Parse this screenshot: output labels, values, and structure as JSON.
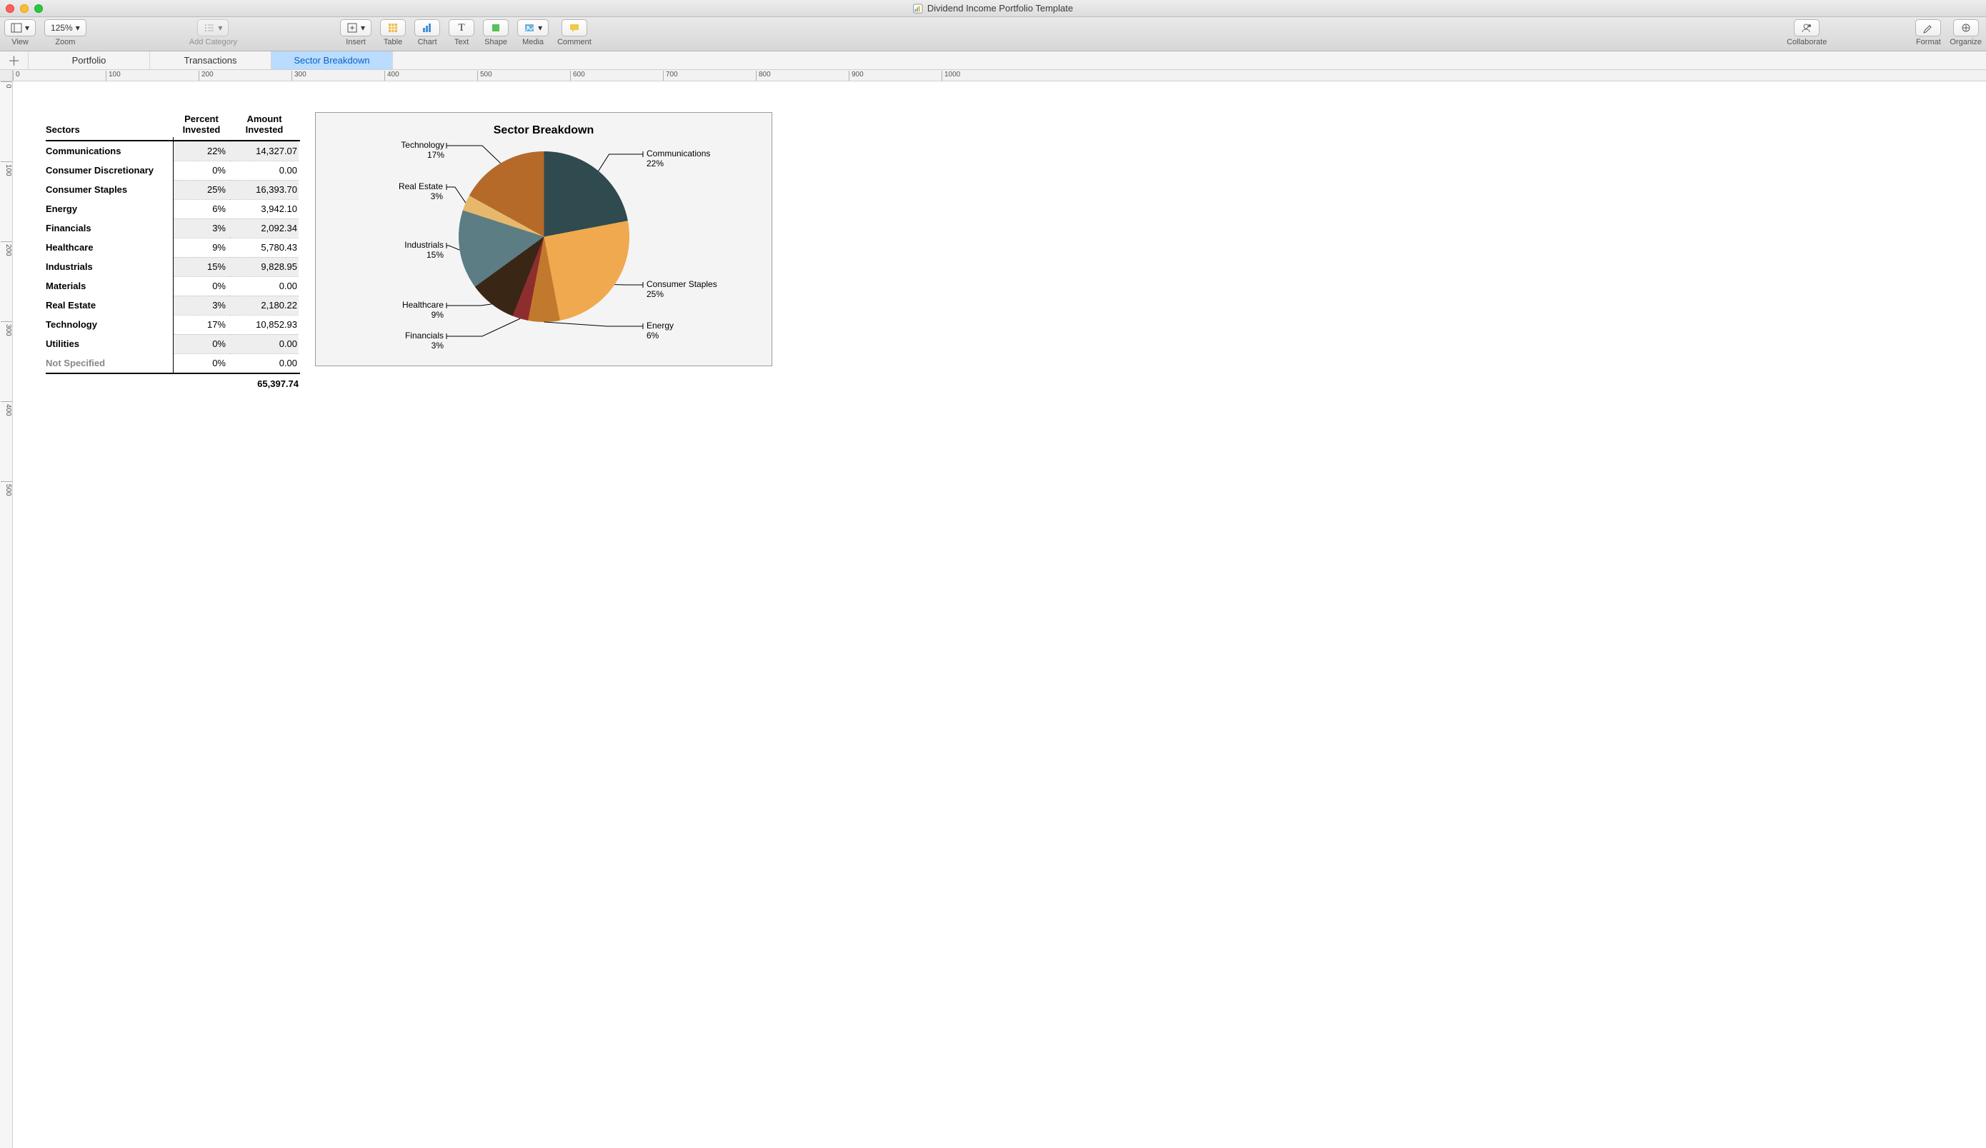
{
  "window": {
    "title": "Dividend Income Portfolio Template"
  },
  "toolbar": {
    "view": "View",
    "zoom_label": "Zoom",
    "zoom_value": "125%",
    "add_category": "Add Category",
    "insert": "Insert",
    "table": "Table",
    "chart": "Chart",
    "text": "Text",
    "shape": "Shape",
    "media": "Media",
    "comment": "Comment",
    "collaborate": "Collaborate",
    "format": "Format",
    "organize": "Organize"
  },
  "tabs": {
    "items": [
      {
        "label": "Portfolio"
      },
      {
        "label": "Transactions"
      },
      {
        "label": "Sector Breakdown"
      }
    ],
    "active_index": 2
  },
  "ruler": {
    "h": [
      "0",
      "100",
      "200",
      "300",
      "400",
      "500",
      "600",
      "700",
      "800",
      "900",
      "1000"
    ],
    "v": [
      "0",
      "100",
      "200",
      "300",
      "400",
      "500"
    ]
  },
  "table": {
    "title": "Sectors",
    "col1": "Percent Invested",
    "col2": "Amount Invested",
    "rows": [
      {
        "sector": "Communications",
        "pct": "22%",
        "amt": "14,327.07"
      },
      {
        "sector": "Consumer Discretionary",
        "pct": "0%",
        "amt": "0.00"
      },
      {
        "sector": "Consumer Staples",
        "pct": "25%",
        "amt": "16,393.70"
      },
      {
        "sector": "Energy",
        "pct": "6%",
        "amt": "3,942.10"
      },
      {
        "sector": "Financials",
        "pct": "3%",
        "amt": "2,092.34"
      },
      {
        "sector": "Healthcare",
        "pct": "9%",
        "amt": "5,780.43"
      },
      {
        "sector": "Industrials",
        "pct": "15%",
        "amt": "9,828.95"
      },
      {
        "sector": "Materials",
        "pct": "0%",
        "amt": "0.00"
      },
      {
        "sector": "Real Estate",
        "pct": "3%",
        "amt": "2,180.22"
      },
      {
        "sector": "Technology",
        "pct": "17%",
        "amt": "10,852.93"
      },
      {
        "sector": "Utilities",
        "pct": "0%",
        "amt": "0.00"
      },
      {
        "sector": "Not Specified",
        "pct": "0%",
        "amt": "0.00",
        "muted": true
      }
    ],
    "total": "65,397.74"
  },
  "chart": {
    "title": "Sector Breakdown",
    "callouts": {
      "comm": {
        "name": "Communications",
        "pct": "22%"
      },
      "staples": {
        "name": "Consumer Staples",
        "pct": "25%"
      },
      "energy": {
        "name": "Energy",
        "pct": "6%"
      },
      "fin": {
        "name": "Financials",
        "pct": "3%"
      },
      "health": {
        "name": "Healthcare",
        "pct": "9%"
      },
      "ind": {
        "name": "Industrials",
        "pct": "15%"
      },
      "re": {
        "name": "Real Estate",
        "pct": "3%"
      },
      "tech": {
        "name": "Technology",
        "pct": "17%"
      }
    }
  },
  "chart_data": {
    "type": "pie",
    "title": "Sector Breakdown",
    "series": [
      {
        "name": "Communications",
        "value": 22,
        "color": "#2f4b4f"
      },
      {
        "name": "Consumer Staples",
        "value": 25,
        "color": "#f0a94e"
      },
      {
        "name": "Energy",
        "value": 6,
        "color": "#c17a2d"
      },
      {
        "name": "Financials",
        "value": 3,
        "color": "#8e2d2d"
      },
      {
        "name": "Healthcare",
        "value": 9,
        "color": "#3a2614"
      },
      {
        "name": "Industrials",
        "value": 15,
        "color": "#5b7d83"
      },
      {
        "name": "Real Estate",
        "value": 3,
        "color": "#e7b86b"
      },
      {
        "name": "Technology",
        "value": 17,
        "color": "#b56a2a"
      }
    ]
  }
}
